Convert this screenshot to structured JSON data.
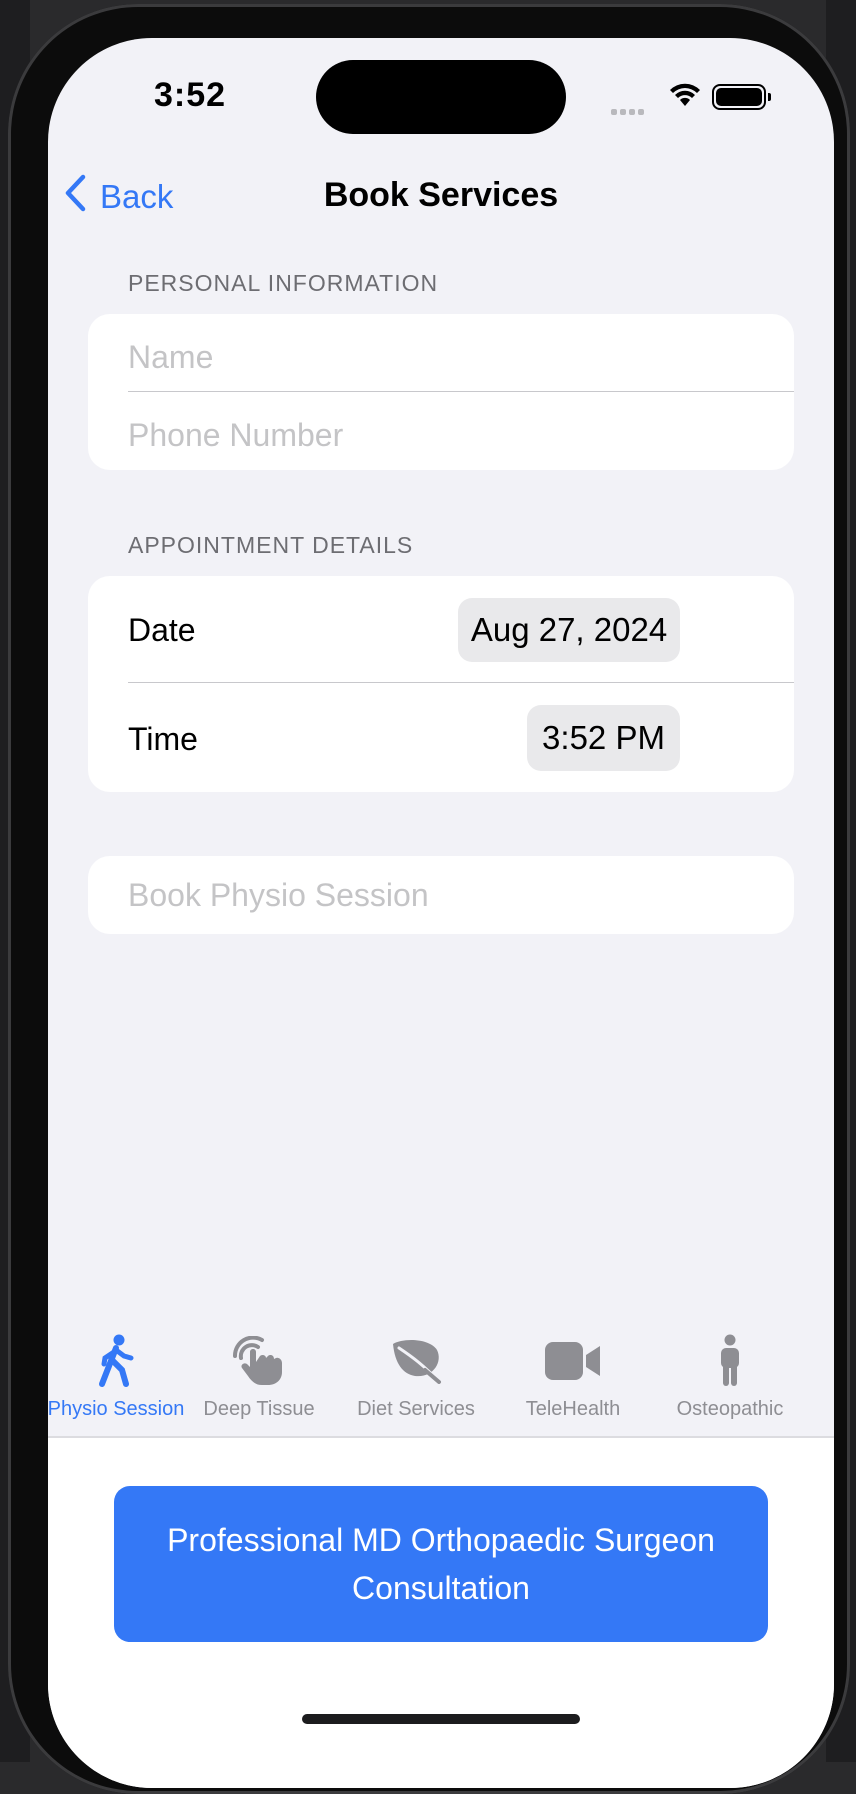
{
  "status_bar": {
    "time": "3:52"
  },
  "nav": {
    "back_label": "Back",
    "title": "Book Services"
  },
  "personal_info": {
    "header": "PERSONAL INFORMATION",
    "name_placeholder": "Name",
    "phone_placeholder": "Phone Number"
  },
  "appointment": {
    "header": "APPOINTMENT DETAILS",
    "date_label": "Date",
    "date_value": "Aug 27, 2024",
    "time_label": "Time",
    "time_value": "3:52 PM"
  },
  "book_field": {
    "placeholder": "Book Physio Session"
  },
  "tabs": [
    {
      "label": "Physio Session",
      "icon": "walking-figure-icon",
      "active": true
    },
    {
      "label": "Deep Tissue",
      "icon": "hand-tap-icon",
      "active": false
    },
    {
      "label": "Diet Services",
      "icon": "leaf-icon",
      "active": false
    },
    {
      "label": "TeleHealth",
      "icon": "video-camera-icon",
      "active": false
    },
    {
      "label": "Osteopathic",
      "icon": "standing-figure-icon",
      "active": false
    }
  ],
  "primary_action": {
    "label": "Professional MD Orthopaedic Surgeon Consultation"
  },
  "colors": {
    "accent": "#3478f6",
    "background": "#f2f2f7",
    "inactive": "#8e8e93"
  }
}
